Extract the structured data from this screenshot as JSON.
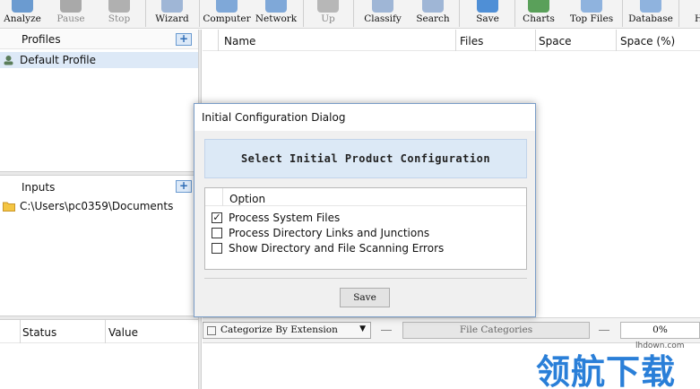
{
  "toolbar": {
    "buttons": [
      {
        "label": "Analyze",
        "state": "enabled"
      },
      {
        "label": "Pause",
        "state": "disabled"
      },
      {
        "label": "Stop",
        "state": "disabled"
      },
      {
        "label": "Wizard",
        "state": "enabled"
      },
      {
        "label": "Computer",
        "state": "enabled"
      },
      {
        "label": "Network",
        "state": "enabled"
      },
      {
        "label": "Up",
        "state": "disabled"
      },
      {
        "label": "Classify",
        "state": "enabled"
      },
      {
        "label": "Search",
        "state": "enabled"
      },
      {
        "label": "Save",
        "state": "enabled"
      },
      {
        "label": "Charts",
        "state": "enabled"
      },
      {
        "label": "Top Files",
        "state": "enabled"
      },
      {
        "label": "Database",
        "state": "enabled"
      },
      {
        "label": "H",
        "state": "enabled"
      }
    ]
  },
  "profiles": {
    "title": "Profiles",
    "items": [
      {
        "label": "Default Profile",
        "selected": true
      }
    ]
  },
  "inputs": {
    "title": "Inputs",
    "items": [
      {
        "label": "C:\\Users\\pc0359\\Documents"
      }
    ]
  },
  "properties": {
    "columns": [
      "Status",
      "Value"
    ]
  },
  "main_list": {
    "columns": [
      "Name",
      "Files",
      "Space",
      "Space (%)"
    ]
  },
  "dialog": {
    "title": "Initial Configuration Dialog",
    "banner": "Select Initial Product Configuration",
    "option_header": "Option",
    "options": [
      {
        "label": "Process System Files",
        "checked": true
      },
      {
        "label": "Process Directory Links and Junctions",
        "checked": false
      },
      {
        "label": "Show Directory and File Scanning Errors",
        "checked": false
      }
    ],
    "save_label": "Save"
  },
  "bottom_bar": {
    "categorize_value": "Categorize By Extension",
    "file_categories_label": "File Categories",
    "progress_text": "0%"
  },
  "watermark": {
    "text": "领航下载",
    "site": "lhdown.com"
  },
  "colors": {
    "selection": "#dde9f7",
    "accent": "#2d6bb5",
    "dialog_banner": "#dce9f6",
    "watermark": "#2a7fd8"
  }
}
